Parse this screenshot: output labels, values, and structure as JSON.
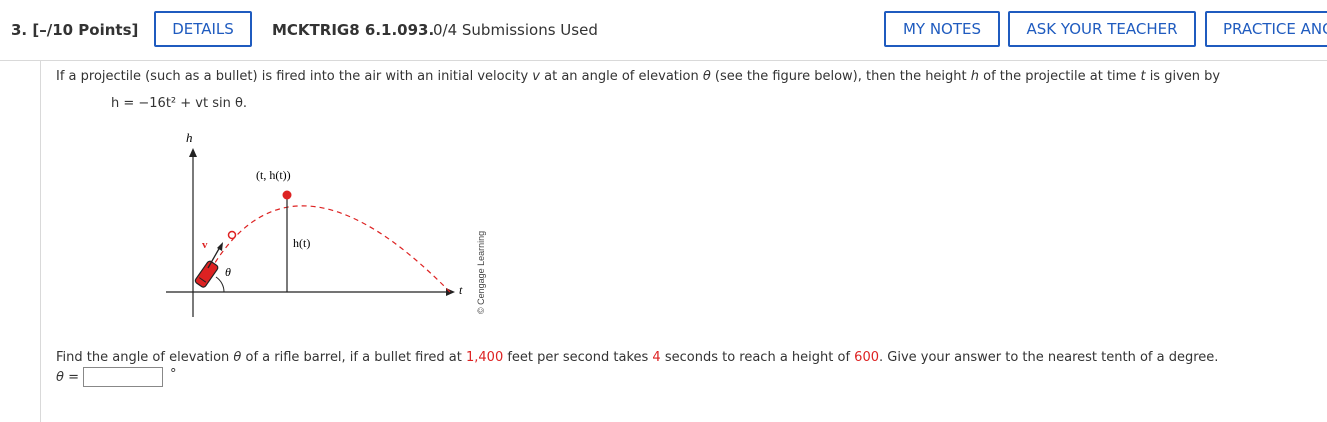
{
  "header": {
    "question_number": "3. [–/10 Points]",
    "details_label": "DETAILS",
    "problem_code": "MCKTRIG8 6.1.093.",
    "submissions": "0/4 Submissions Used",
    "my_notes_label": "MY NOTES",
    "ask_teacher_label": "ASK YOUR TEACHER",
    "practice_label": "PRACTICE ANO"
  },
  "problem": {
    "intro_1": "If a projectile (such as a bullet) is fired into the air with an initial velocity ",
    "intro_v": "v",
    "intro_2": " at an angle of elevation ",
    "intro_theta": "θ",
    "intro_3": " (see the figure below), then the height ",
    "intro_h": "h",
    "intro_4": " of the projectile at time ",
    "intro_t": "t",
    "intro_5": " is given by",
    "formula": "h = −16t² + vt sin θ.",
    "question_1": "Find the angle of elevation ",
    "question_theta": "θ",
    "question_2": " of a rifle barrel, if a bullet fired at ",
    "velocity": "1,400",
    "question_3": " feet per second takes ",
    "time": "4",
    "question_4": " seconds to reach a height of ",
    "height": "600",
    "question_5": ". Give your answer to the nearest tenth of a degree.",
    "answer_label": "θ =",
    "answer_value": "",
    "degree_symbol": "°"
  },
  "figure": {
    "h_axis_label": "h",
    "t_axis_label": "t",
    "point_label": "(t, h(t))",
    "height_label": "h(t)",
    "v_label": "v",
    "theta_label": "θ",
    "copyright": "© Cengage Learning"
  },
  "colors": {
    "accent": "#1f5bbf",
    "highlight": "#dd2222"
  }
}
